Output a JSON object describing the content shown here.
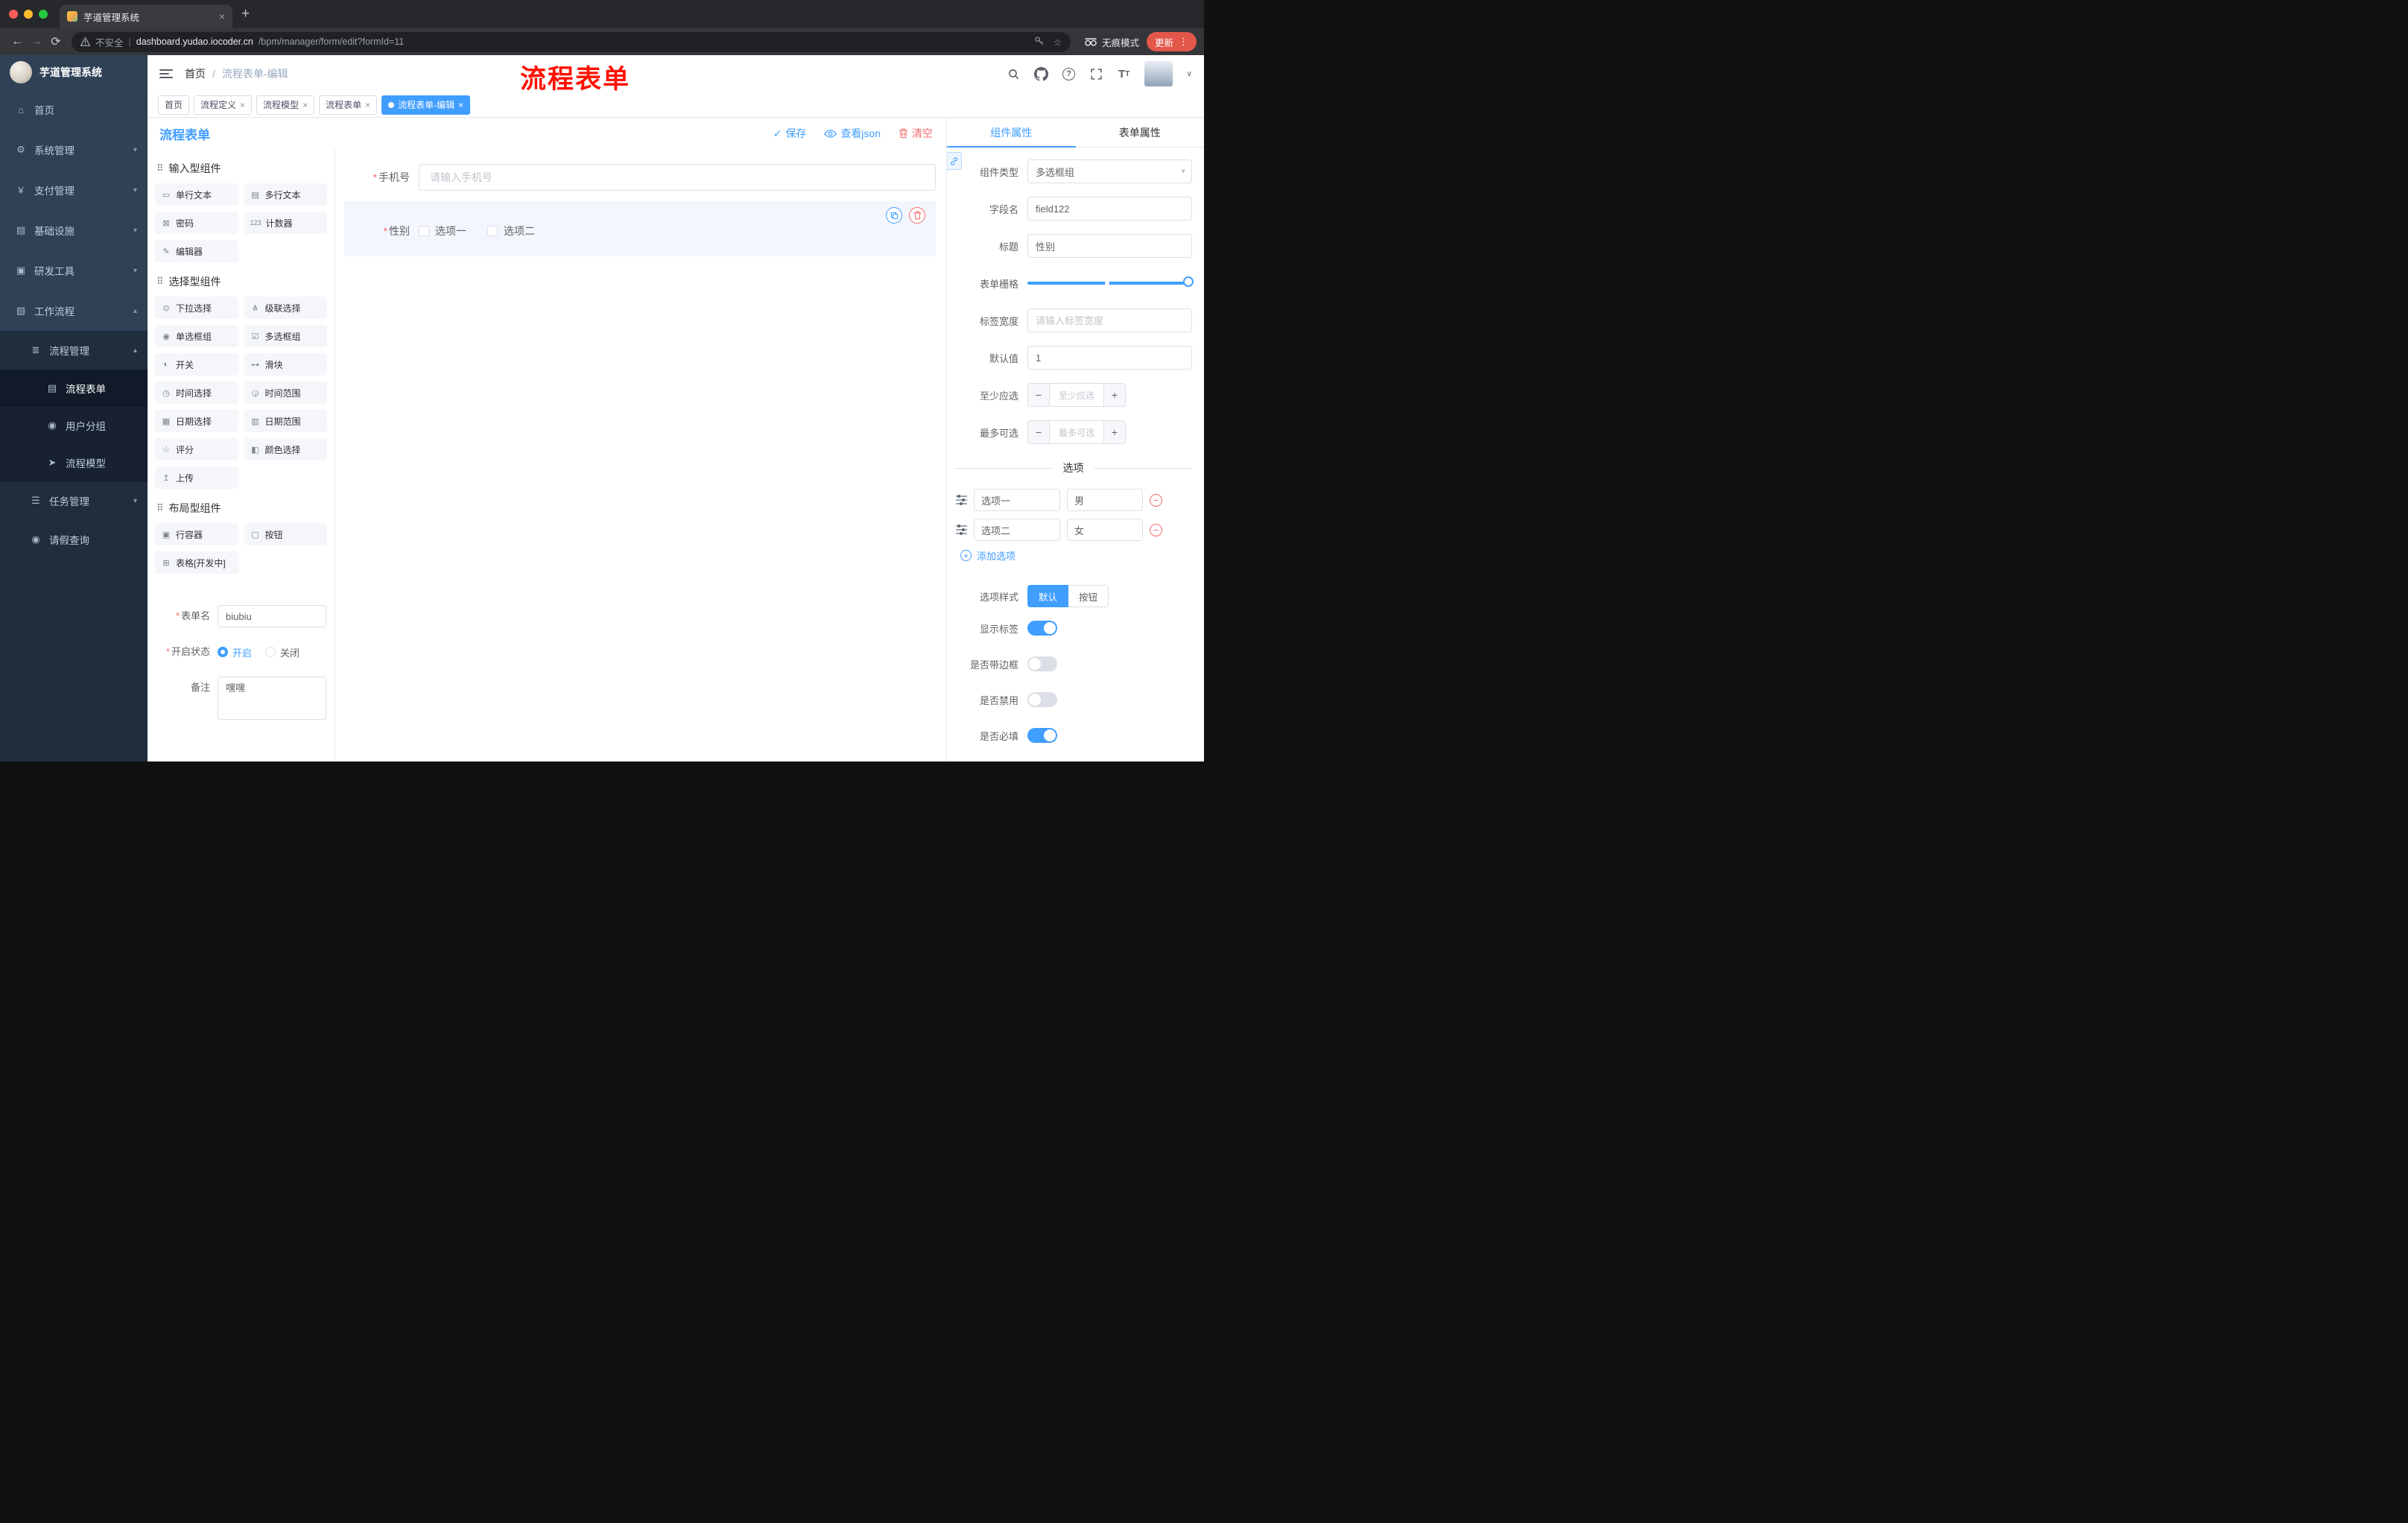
{
  "colors": {
    "accent": "#409eff",
    "danger": "#f56c6c",
    "annotation": "#fe1100",
    "sidebar_bg": "#304156",
    "tag_active_bg": "#409eff",
    "update_pill_bg": "#e3574a"
  },
  "icons": {
    "close": "×",
    "plus": "+",
    "back": "←",
    "forward": "→",
    "reload": "⟳",
    "star": "☆",
    "menu_dots": "⋮",
    "caret_down": "▾",
    "caret_up": "▴",
    "check": "✓",
    "divider": "|",
    "minus": "−",
    "add": "+",
    "question": "?",
    "tsize_big": "T",
    "tsize_small": "T",
    "av_caret": "∨"
  },
  "browser": {
    "tab_title": "芋道管理系统",
    "security_label": "不安全",
    "url_domain": "dashboard.yudao.iocoder.cn",
    "url_path": "/bpm/manager/form/edit?formId=11",
    "incognito_label": "无痕模式",
    "update_label": "更新"
  },
  "sidebar": {
    "logo_title": "芋道管理系统",
    "items": [
      {
        "label": "首页",
        "icon": "⌂"
      },
      {
        "label": "系统管理",
        "icon": "⚙"
      },
      {
        "label": "支付管理",
        "icon": "¥"
      },
      {
        "label": "基础设施",
        "icon": "▤"
      },
      {
        "label": "研发工具",
        "icon": "▣"
      },
      {
        "label": "工作流程",
        "icon": "▧"
      },
      {
        "label": "流程管理",
        "icon": "≣"
      },
      {
        "label": "流程表单",
        "icon": "▤"
      },
      {
        "label": "用户分组",
        "icon": "◉"
      },
      {
        "label": "流程模型",
        "icon": "➤"
      },
      {
        "label": "任务管理",
        "icon": "☰"
      },
      {
        "label": "请假查询",
        "icon": "◉"
      }
    ]
  },
  "header": {
    "breadcrumb_home": "首页",
    "breadcrumb_sep": "/",
    "breadcrumb_current": "流程表单-编辑",
    "annotation": "流程表单"
  },
  "tags": [
    {
      "label": "首页"
    },
    {
      "label": "流程定义"
    },
    {
      "label": "流程模型"
    },
    {
      "label": "流程表单"
    },
    {
      "label": "流程表单-编辑"
    }
  ],
  "designer": {
    "title": "流程表单",
    "actions": {
      "save": "保存",
      "view_json": "查看json",
      "clear": "清空"
    },
    "palette": {
      "groups": [
        {
          "title": "输入型组件",
          "items": [
            {
              "label": "单行文本",
              "icon": "▭"
            },
            {
              "label": "多行文本",
              "icon": "▤"
            },
            {
              "label": "密码",
              "icon": "⊠"
            },
            {
              "label": "计数器",
              "icon": "123"
            },
            {
              "label": "编辑器",
              "icon": "✎"
            }
          ]
        },
        {
          "title": "选择型组件",
          "items": [
            {
              "label": "下拉选择",
              "icon": "⊙"
            },
            {
              "label": "级联选择",
              "icon": "⋔"
            },
            {
              "label": "单选框组",
              "icon": "◉"
            },
            {
              "label": "多选框组",
              "icon": "☑"
            },
            {
              "label": "开关",
              "icon": "◐"
            },
            {
              "label": "滑块",
              "icon": "⊶"
            },
            {
              "label": "时间选择",
              "icon": "◷"
            },
            {
              "label": "时间范围",
              "icon": "◶"
            },
            {
              "label": "日期选择",
              "icon": "▦"
            },
            {
              "label": "日期范围",
              "icon": "▥"
            },
            {
              "label": "评分",
              "icon": "☆"
            },
            {
              "label": "颜色选择",
              "icon": "◧"
            },
            {
              "label": "上传",
              "icon": "↥"
            }
          ]
        },
        {
          "title": "布局型组件",
          "items": [
            {
              "label": "行容器",
              "icon": "▣"
            },
            {
              "label": "按钮",
              "icon": "▢"
            },
            {
              "label": "表格[开发中]",
              "icon": "⊞"
            }
          ]
        }
      ]
    },
    "form_meta": {
      "name_label": "表单名",
      "name_value": "biubiu",
      "status_label": "开启状态",
      "status_options": [
        "开启",
        "关闭"
      ],
      "remark_label": "备注",
      "remark_value": "嘿嘿"
    },
    "canvas": {
      "phone": {
        "label": "手机号",
        "placeholder": "请输入手机号"
      },
      "gender": {
        "label": "性别",
        "options": [
          "选项一",
          "选项二"
        ]
      }
    }
  },
  "properties": {
    "tabs": [
      "组件属性",
      "表单属性"
    ],
    "component_type_label": "组件类型",
    "component_type_value": "多选框组",
    "field_label": "字段名",
    "field_value": "field122",
    "title_label": "标题",
    "title_value": "性别",
    "grid_label": "表单栅格",
    "label_width_label": "标签宽度",
    "label_width_placeholder": "请输入标签宽度",
    "default_label": "默认值",
    "default_value": "1",
    "min_label": "至少应选",
    "min_placeholder": "至少应选",
    "max_label": "最多可选",
    "max_placeholder": "最多可选",
    "options_title": "选项",
    "options": [
      {
        "label": "选项一",
        "value": "男"
      },
      {
        "label": "选项二",
        "value": "女"
      }
    ],
    "add_option": "添加选项",
    "style_label": "选项样式",
    "style_options": [
      "默认",
      "按钮"
    ],
    "switches": [
      {
        "label": "显示标签",
        "on": true
      },
      {
        "label": "是否带边框",
        "on": false
      },
      {
        "label": "是否禁用",
        "on": false
      },
      {
        "label": "是否必填",
        "on": true
      }
    ]
  }
}
